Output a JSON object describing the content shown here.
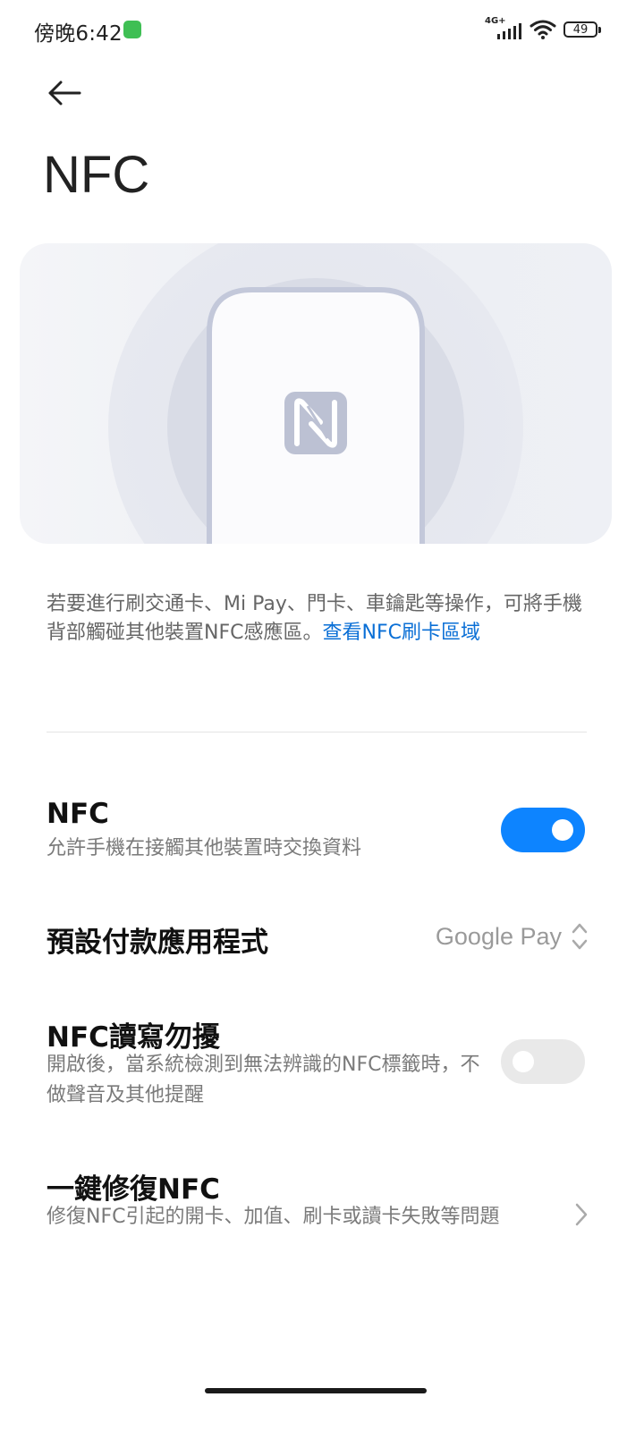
{
  "status_bar": {
    "time": "傍晚6:42",
    "network": "4G+",
    "battery": "49",
    "icons": [
      "app-notification-icon",
      "signal-icon",
      "wifi-icon",
      "battery-icon"
    ]
  },
  "header": {
    "back_icon": "arrow-left-icon",
    "title": "NFC"
  },
  "illustration": {
    "icon": "nfc-n-icon",
    "colors": {
      "background": "#f0f1f5",
      "ring_outer": "#e6e8ef",
      "ring_inner": "#d6d9e4",
      "phone_outline": "#c3c8da",
      "nfc_mark": "#bcc1d3"
    }
  },
  "description": {
    "text": "若要進行刷交通卡、Mi Pay、門卡、車鑰匙等操作，可將手機背部觸碰其他裝置NFC感應區。",
    "link": "查看NFC刷卡區域"
  },
  "settings": {
    "nfc": {
      "title": "NFC",
      "subtitle": "允許手機在接觸其他裝置時交換資料",
      "enabled": true
    },
    "default_payment": {
      "title": "預設付款應用程式",
      "value": "Google Pay"
    },
    "nfc_dnd": {
      "title": "NFC讀寫勿擾",
      "subtitle": "開啟後，當系統檢測到無法辨識的NFC標籤時，不做聲音及其他提醒",
      "enabled": false
    },
    "one_click_repair": {
      "title": "一鍵修復NFC",
      "subtitle": "修復NFC引起的開卡、加值、刷卡或讀卡失敗等問題"
    }
  },
  "colors": {
    "accent": "#0d84ff",
    "link": "#0a6fd6",
    "toggle_off": "#e9e9e9"
  }
}
